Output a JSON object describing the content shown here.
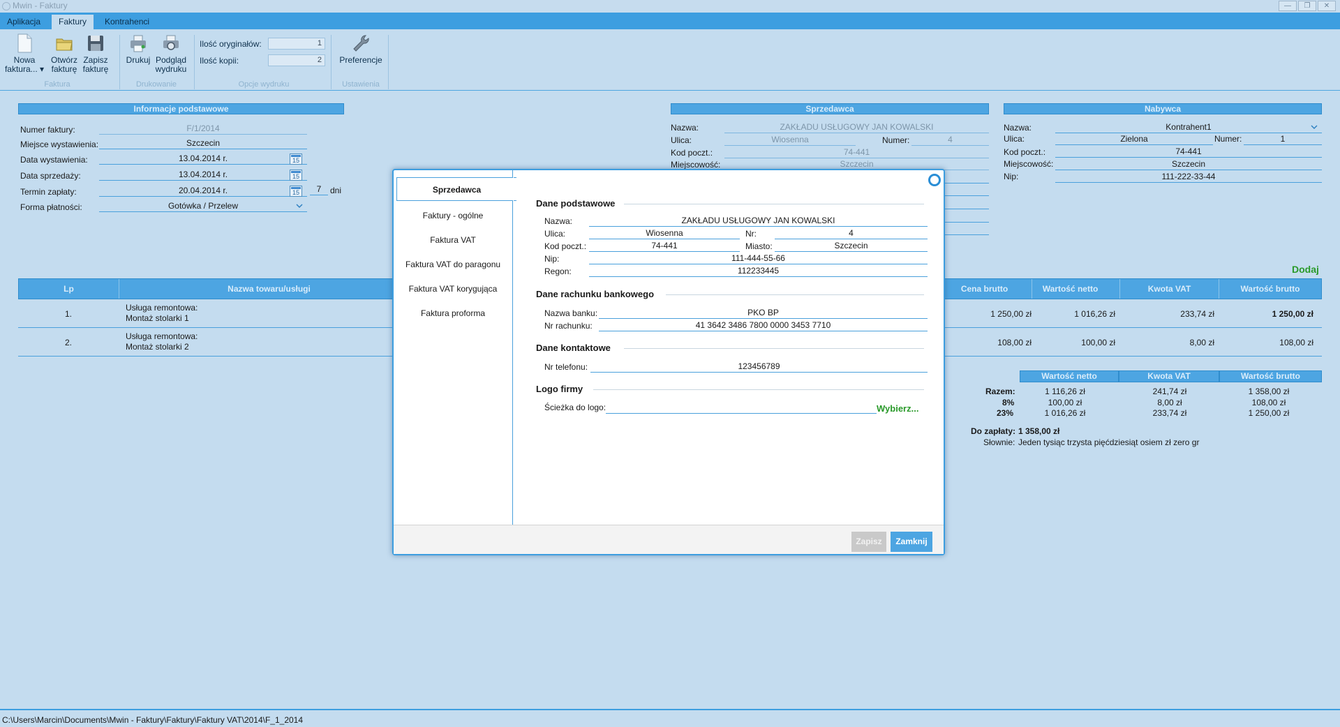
{
  "window": {
    "title": "Mwin - Faktury",
    "controls": [
      "—",
      "❐",
      "✕"
    ]
  },
  "menu": {
    "tabs": [
      "Aplikacja",
      "Faktury",
      "Kontrahenci"
    ],
    "active": "Faktury"
  },
  "ribbon": {
    "new_invoice": "Nowa\nfaktura... ▾",
    "open_invoice": "Otwórz\nfakturę",
    "save_invoice": "Zapisz\nfakturę",
    "print": "Drukuj",
    "print_preview": "Podgląd\nwydruku",
    "originals_label": "Ilość oryginałów:",
    "originals_value": "1",
    "copies_label": "Ilość kopii:",
    "copies_value": "2",
    "preferences": "Preferencje",
    "groups": {
      "invoice": "Faktura",
      "printing": "Drukowanie",
      "print_options": "Opcje wydruku",
      "settings": "Ustawienia"
    }
  },
  "basic_info": {
    "header": "Informacje podstawowe",
    "invoice_number_label": "Numer faktury:",
    "invoice_number": "F/1/2014",
    "issue_place_label": "Miejsce wystawienia:",
    "issue_place": "Szczecin",
    "issue_date_label": "Data wystawienia:",
    "issue_date": "13.04.2014 r.",
    "sale_date_label": "Data sprzedaży:",
    "sale_date": "13.04.2014 r.",
    "due_label": "Termin zapłaty:",
    "due_date": "20.04.2014 r.",
    "due_days": "7",
    "days_suffix": "dni",
    "payment_label": "Forma płatności:",
    "payment": "Gotówka / Przelew",
    "calendar_day": "15"
  },
  "seller": {
    "header": "Sprzedawca",
    "name_label": "Nazwa:",
    "name": "ZAKŁADU USŁUGOWY JAN KOWALSKI",
    "street_label": "Ulica:",
    "street": "Wiosenna",
    "number_label": "Numer:",
    "number": "4",
    "postal_label": "Kod poczt.:",
    "postal": "74-441",
    "city_label": "Miejscowość:",
    "city": "Szczecin"
  },
  "buyer": {
    "header": "Nabywca",
    "name_label": "Nazwa:",
    "name": "Kontrahent1",
    "street_label": "Ulica:",
    "street": "Zielona",
    "number_label": "Numer:",
    "number": "1",
    "postal_label": "Kod poczt.:",
    "postal": "74-441",
    "city_label": "Miejscowość:",
    "city": "Szczecin",
    "nip_label": "Nip:",
    "nip": "111-222-33-44"
  },
  "items": {
    "add_label": "Dodaj",
    "columns": [
      "Lp",
      "Nazwa towaru/usługi",
      "Cena brutto",
      "Wartość netto",
      "Kwota VAT",
      "Wartość brutto"
    ],
    "rows": [
      {
        "lp": "1.",
        "name1": "Usługa remontowa:",
        "name2": "Montaż stolarki 1",
        "gross_price": "1 250,00 zł",
        "net_value": "1 016,26 zł",
        "vat_amount": "233,74 zł",
        "gross_value": "1 250,00 zł"
      },
      {
        "lp": "2.",
        "name1": "Usługa remontowa:",
        "name2": "Montaż stolarki 2",
        "gross_price": "108,00 zł",
        "net_value": "100,00 zł",
        "vat_amount": "8,00 zł",
        "gross_value": "108,00 zł"
      }
    ]
  },
  "summary": {
    "columns": [
      "Wartość netto",
      "Kwota VAT",
      "Wartość brutto"
    ],
    "rows": [
      {
        "label": "Razem:",
        "net": "1 116,26 zł",
        "vat": "241,74 zł",
        "gross": "1 358,00 zł"
      },
      {
        "label": "8%",
        "net": "100,00 zł",
        "vat": "8,00 zł",
        "gross": "108,00 zł"
      },
      {
        "label": "23%",
        "net": "1 016,26 zł",
        "vat": "233,74 zł",
        "gross": "1 250,00 zł"
      }
    ],
    "to_pay_label": "Do zapłaty:",
    "to_pay": "1 358,00 zł",
    "words_label": "Słownie:",
    "words": "Jeden tysiąc trzysta pięćdziesiąt osiem zł zero gr"
  },
  "status_path": "C:\\Users\\Marcin\\Documents\\Mwin - Faktury\\Faktury\\Faktury VAT\\2014\\F_1_2014",
  "modal": {
    "nav": [
      "Sprzedawca",
      "Faktury - ogólne",
      "Faktura VAT",
      "Faktura VAT do paragonu",
      "Faktura VAT korygująca",
      "Faktura proforma"
    ],
    "sections": {
      "basic": "Dane podstawowe",
      "bank": "Dane rachunku bankowego",
      "contact": "Dane kontaktowe",
      "logo": "Logo firmy"
    },
    "fields": {
      "name_label": "Nazwa:",
      "name": "ZAKŁADU USŁUGOWY JAN KOWALSKI",
      "street_label": "Ulica:",
      "street": "Wiosenna",
      "nr_label": "Nr:",
      "nr": "4",
      "postal_label": "Kod poczt.:",
      "postal": "74-441",
      "city_label": "Miasto:",
      "city": "Szczecin",
      "nip_label": "Nip:",
      "nip": "111-444-55-66",
      "regon_label": "Regon:",
      "regon": "112233445",
      "bank_label": "Nazwa banku:",
      "bank": "PKO BP",
      "account_label": "Nr rachunku:",
      "account": "41 3642 3486 7800 0000 3453 7710",
      "phone_label": "Nr telefonu:",
      "phone": "123456789",
      "logo_path_label": "Ścieżka do logo:",
      "logo_path": "",
      "choose": "Wybierz..."
    },
    "save": "Zapisz",
    "close": "Zamknij"
  },
  "colors": {
    "accent": "#3d9ee0",
    "background": "#c4dcef",
    "green": "#2a9a2a",
    "save_disabled": "#c9c9c9",
    "close_button": "#4da5e2"
  }
}
